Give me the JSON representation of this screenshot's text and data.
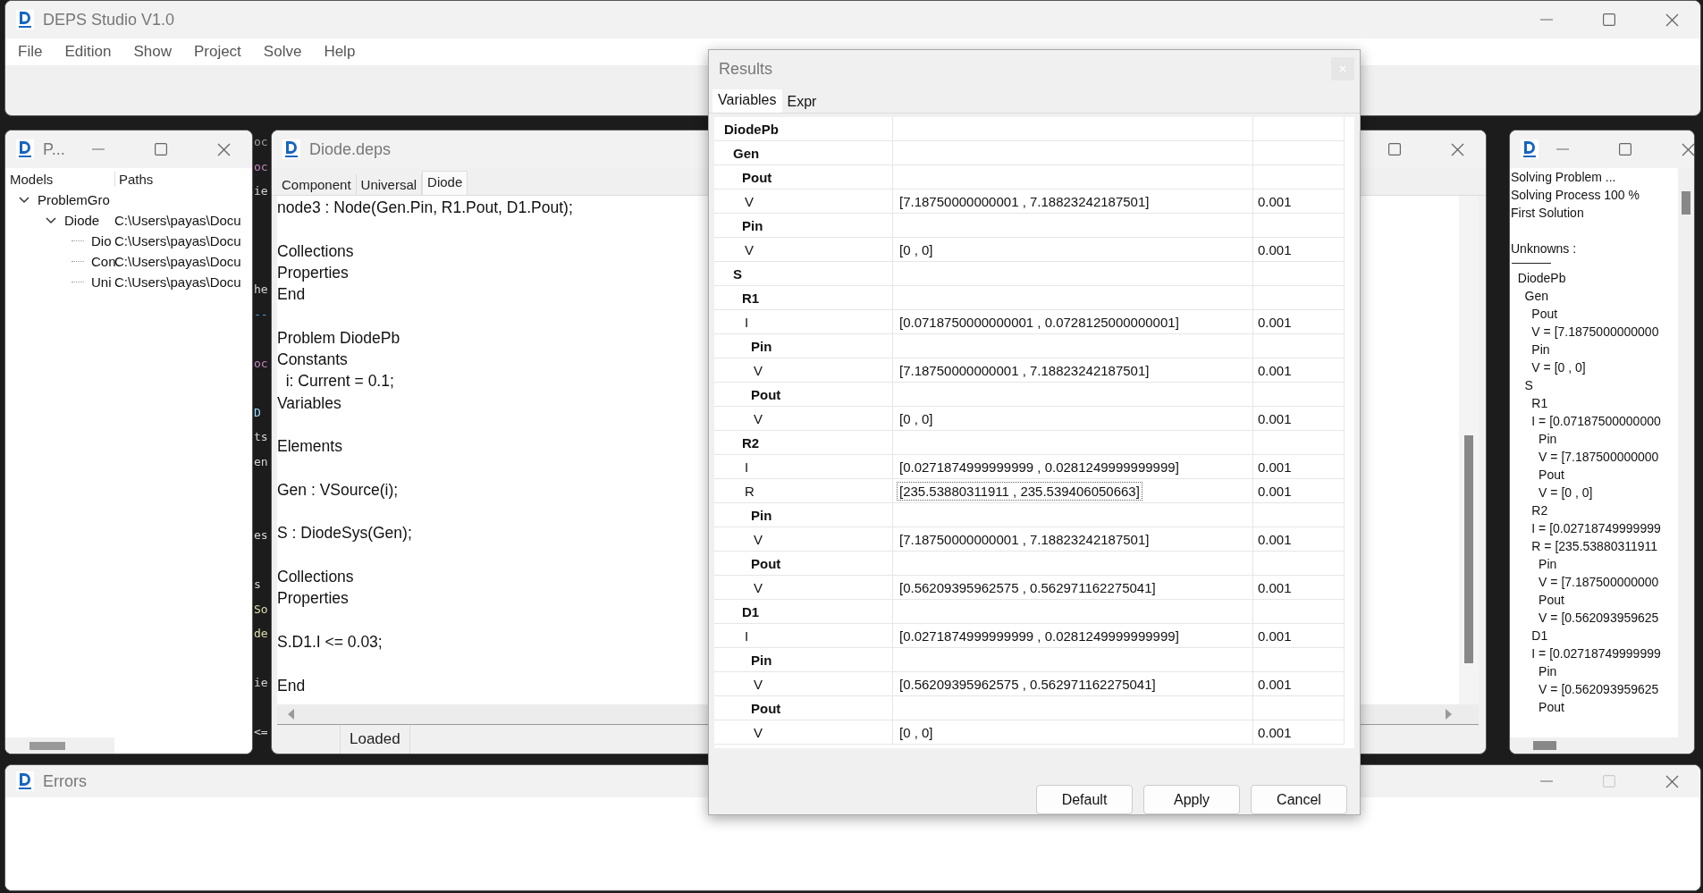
{
  "app": {
    "title": "DEPS Studio V1.0",
    "menu": [
      "File",
      "Edition",
      "Show",
      "Project",
      "Solve",
      "Help"
    ]
  },
  "background_fragments": [
    {
      "kind": "text",
      "text": "oc",
      "color": "#9d9d9d"
    },
    {
      "kind": "text",
      "text": "oc",
      "color": "#c586c0"
    },
    {
      "kind": "text",
      "text": "ie",
      "color": "#d4d4d4"
    },
    {
      "kind": "blank"
    },
    {
      "kind": "blank"
    },
    {
      "kind": "blank"
    },
    {
      "kind": "text",
      "text": "he",
      "color": "#d4d4d4"
    },
    {
      "kind": "text",
      "text": "--",
      "color": "#569cd6"
    },
    {
      "kind": "blank"
    },
    {
      "kind": "text",
      "text": "oc",
      "color": "#c586c0"
    },
    {
      "kind": "blank"
    },
    {
      "kind": "text",
      "text": "D",
      "color": "#9cdcfe"
    },
    {
      "kind": "text",
      "text": "ts",
      "color": "#d4d4d4"
    },
    {
      "kind": "text",
      "text": "en",
      "color": "#d4d4d4"
    },
    {
      "kind": "blank"
    },
    {
      "kind": "blank"
    },
    {
      "kind": "text",
      "text": "es",
      "color": "#d4d4d4"
    },
    {
      "kind": "blank"
    },
    {
      "kind": "text",
      "text": "s",
      "color": "#d4d4d4"
    },
    {
      "kind": "text",
      "text": "So",
      "color": "#dcdcaa"
    },
    {
      "kind": "text",
      "text": "de",
      "color": "#dcdcaa"
    },
    {
      "kind": "blank"
    },
    {
      "kind": "text",
      "text": "ie",
      "color": "#d4d4d4"
    },
    {
      "kind": "blank"
    },
    {
      "kind": "text",
      "text": "<=",
      "color": "#d4d4d4"
    }
  ],
  "project_window": {
    "title": "P...",
    "columns": [
      "Models",
      "Paths"
    ],
    "models": [
      {
        "name": "ProblemGro",
        "expanded": true,
        "children": [
          {
            "name": "Diode",
            "path": "C:\\Users\\payas\\Docu",
            "expanded": true,
            "children": [
              {
                "name": "Dio",
                "path": "C:\\Users\\payas\\Docu"
              },
              {
                "name": "Con",
                "path": "C:\\Users\\payas\\Docu"
              },
              {
                "name": "Uni",
                "path": "C:\\Users\\payas\\Docu"
              }
            ]
          }
        ]
      }
    ]
  },
  "editor_window": {
    "title": "Diode.deps",
    "tabs": [
      {
        "label": "Component",
        "selected": false
      },
      {
        "label": "Universal",
        "selected": false
      },
      {
        "label": "Diode",
        "selected": true
      }
    ],
    "lines": [
      {
        "kind": "code",
        "text": "node3 : Node(Gen.Pin, R1.Pout, D1.Pout);"
      },
      {
        "kind": "blank"
      },
      {
        "kind": "code",
        "text": "Collections"
      },
      {
        "kind": "code",
        "text": "Properties"
      },
      {
        "kind": "code",
        "text": "End"
      },
      {
        "kind": "blank"
      },
      {
        "kind": "code",
        "text": "Problem DiodePb"
      },
      {
        "kind": "code",
        "text": "Constants"
      },
      {
        "kind": "code",
        "text": "  i: Current = 0.1;"
      },
      {
        "kind": "code",
        "text": "Variables"
      },
      {
        "kind": "blank"
      },
      {
        "kind": "code",
        "text": "Elements"
      },
      {
        "kind": "blank"
      },
      {
        "kind": "code",
        "text": "Gen : VSource(i);"
      },
      {
        "kind": "blank"
      },
      {
        "kind": "code",
        "text": "S : DiodeSys(Gen);"
      },
      {
        "kind": "blank"
      },
      {
        "kind": "code",
        "text": "Collections"
      },
      {
        "kind": "code",
        "text": "Properties"
      },
      {
        "kind": "blank"
      },
      {
        "kind": "code",
        "text": "S.D1.I <= 0.03;"
      },
      {
        "kind": "blank"
      },
      {
        "kind": "code",
        "text": "End"
      }
    ],
    "status": "Loaded"
  },
  "results_dialog": {
    "title": "Results",
    "tabs": [
      {
        "label": "Variables",
        "selected": true
      },
      {
        "label": "Expr",
        "selected": false
      }
    ],
    "rows": [
      {
        "kind": "group",
        "name": "DiodePb",
        "children": [
          {
            "kind": "group",
            "name": "Gen",
            "children": [
              {
                "kind": "group",
                "name": "Pout",
                "children": [
                  {
                    "kind": "variable",
                    "name": "V",
                    "value": "[7.18750000000001 , 7.18823242187501]",
                    "precision": "0.001",
                    "selected": false
                  }
                ]
              },
              {
                "kind": "group",
                "name": "Pin",
                "children": [
                  {
                    "kind": "variable",
                    "name": "V",
                    "value": "[0 , 0]",
                    "precision": "0.001",
                    "selected": false
                  }
                ]
              }
            ]
          },
          {
            "kind": "group",
            "name": "S",
            "children": [
              {
                "kind": "group",
                "name": "R1",
                "children": [
                  {
                    "kind": "variable",
                    "name": "I",
                    "value": "[0.0718750000000001 , 0.0728125000000001]",
                    "precision": "0.001",
                    "selected": false
                  },
                  {
                    "kind": "group",
                    "name": "Pin",
                    "children": [
                      {
                        "kind": "variable",
                        "name": "V",
                        "value": "[7.18750000000001 , 7.18823242187501]",
                        "precision": "0.001",
                        "selected": false
                      }
                    ]
                  },
                  {
                    "kind": "group",
                    "name": "Pout",
                    "children": [
                      {
                        "kind": "variable",
                        "name": "V",
                        "value": "[0 , 0]",
                        "precision": "0.001",
                        "selected": false
                      }
                    ]
                  }
                ]
              },
              {
                "kind": "group",
                "name": "R2",
                "children": [
                  {
                    "kind": "variable",
                    "name": "I",
                    "value": "[0.0271874999999999 , 0.0281249999999999]",
                    "precision": "0.001",
                    "selected": false
                  },
                  {
                    "kind": "variable",
                    "name": "R",
                    "value": "[235.53880311911 , 235.539406050663]",
                    "precision": "0.001",
                    "selected": true
                  },
                  {
                    "kind": "group",
                    "name": "Pin",
                    "children": [
                      {
                        "kind": "variable",
                        "name": "V",
                        "value": "[7.18750000000001 , 7.18823242187501]",
                        "precision": "0.001",
                        "selected": false
                      }
                    ]
                  },
                  {
                    "kind": "group",
                    "name": "Pout",
                    "children": [
                      {
                        "kind": "variable",
                        "name": "V",
                        "value": "[0.56209395962575 , 0.562971162275041]",
                        "precision": "0.001",
                        "selected": false
                      }
                    ]
                  }
                ]
              },
              {
                "kind": "group",
                "name": "D1",
                "children": [
                  {
                    "kind": "variable",
                    "name": "I",
                    "value": "[0.0271874999999999 , 0.0281249999999999]",
                    "precision": "0.001",
                    "selected": false
                  },
                  {
                    "kind": "group",
                    "name": "Pin",
                    "children": [
                      {
                        "kind": "variable",
                        "name": "V",
                        "value": "[0.56209395962575 , 0.562971162275041]",
                        "precision": "0.001",
                        "selected": false
                      }
                    ]
                  },
                  {
                    "kind": "group",
                    "name": "Pout",
                    "children": [
                      {
                        "kind": "variable",
                        "name": "V",
                        "value": "[0 , 0]",
                        "precision": "0.001",
                        "selected": false
                      }
                    ]
                  }
                ]
              }
            ]
          }
        ]
      }
    ],
    "buttons": [
      "Default",
      "Apply",
      "Cancel"
    ]
  },
  "console_window": {
    "lines": [
      {
        "kind": "text",
        "text": "Solving Problem ..."
      },
      {
        "kind": "text",
        "text": "Solving Process 100 %"
      },
      {
        "kind": "text",
        "text": "First Solution"
      },
      {
        "kind": "blank"
      },
      {
        "kind": "text",
        "text": "Unknowns :"
      },
      {
        "kind": "rule"
      },
      {
        "kind": "text",
        "text": "  DiodePb"
      },
      {
        "kind": "text",
        "text": "    Gen"
      },
      {
        "kind": "text",
        "text": "      Pout"
      },
      {
        "kind": "text",
        "text": "      V = [7.1875000000000"
      },
      {
        "kind": "text",
        "text": "      Pin"
      },
      {
        "kind": "text",
        "text": "      V = [0 , 0]"
      },
      {
        "kind": "text",
        "text": "    S"
      },
      {
        "kind": "text",
        "text": "      R1"
      },
      {
        "kind": "text",
        "text": "      I = [0.07187500000000"
      },
      {
        "kind": "text",
        "text": "        Pin"
      },
      {
        "kind": "text",
        "text": "        V = [7.187500000000"
      },
      {
        "kind": "text",
        "text": "        Pout"
      },
      {
        "kind": "text",
        "text": "        V = [0 , 0]"
      },
      {
        "kind": "text",
        "text": "      R2"
      },
      {
        "kind": "text",
        "text": "      I = [0.02718749999999"
      },
      {
        "kind": "text",
        "text": "      R = [235.53880311911"
      },
      {
        "kind": "text",
        "text": "        Pin"
      },
      {
        "kind": "text",
        "text": "        V = [7.187500000000"
      },
      {
        "kind": "text",
        "text": "        Pout"
      },
      {
        "kind": "text",
        "text": "        V = [0.562093959625"
      },
      {
        "kind": "text",
        "text": "      D1"
      },
      {
        "kind": "text",
        "text": "      I = [0.02718749999999"
      },
      {
        "kind": "text",
        "text": "        Pin"
      },
      {
        "kind": "text",
        "text": "        V = [0.562093959625"
      },
      {
        "kind": "text",
        "text": "        Pout"
      }
    ]
  },
  "errors_window": {
    "title": "Errors"
  }
}
